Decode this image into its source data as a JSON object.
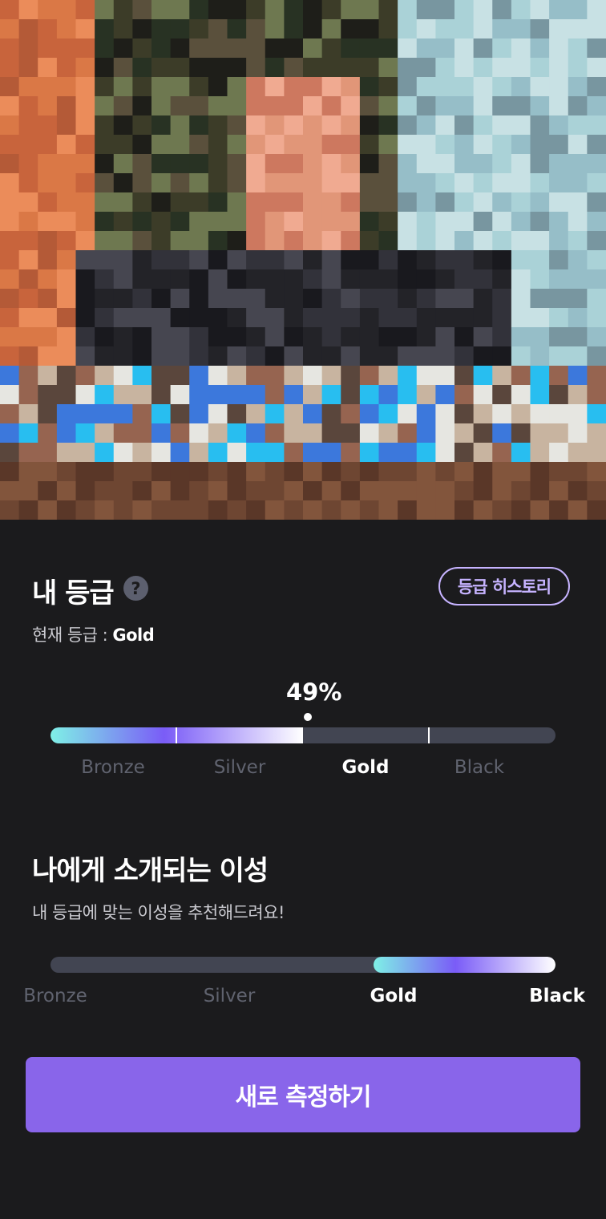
{
  "photo": {
    "description_icon": "pixelated-profile-photo"
  },
  "grade": {
    "title": "내 등급",
    "help_icon": "?",
    "history_label": "등급 히스토리",
    "current_prefix": "현재 등급 : ",
    "current_value": "Gold",
    "percent_label": "49%",
    "percent": 49,
    "tiers": [
      "Bronze",
      "Silver",
      "Gold",
      "Black"
    ],
    "active_tier": "Gold"
  },
  "intro": {
    "title": "나에게 소개되는 이성",
    "subtitle": "내 등급에 맞는 이성을 추천해드려요!",
    "tiers": [
      "Bronze",
      "Silver",
      "Gold",
      "Black"
    ],
    "active_tiers": [
      "Gold",
      "Black"
    ]
  },
  "cta": {
    "label": "새로 측정하기"
  },
  "colors": {
    "background": "#1b1b1d",
    "accent": "#8965ea",
    "outline_accent": "#c6b3ff",
    "track": "#424552",
    "inactive_text": "#60636f"
  }
}
